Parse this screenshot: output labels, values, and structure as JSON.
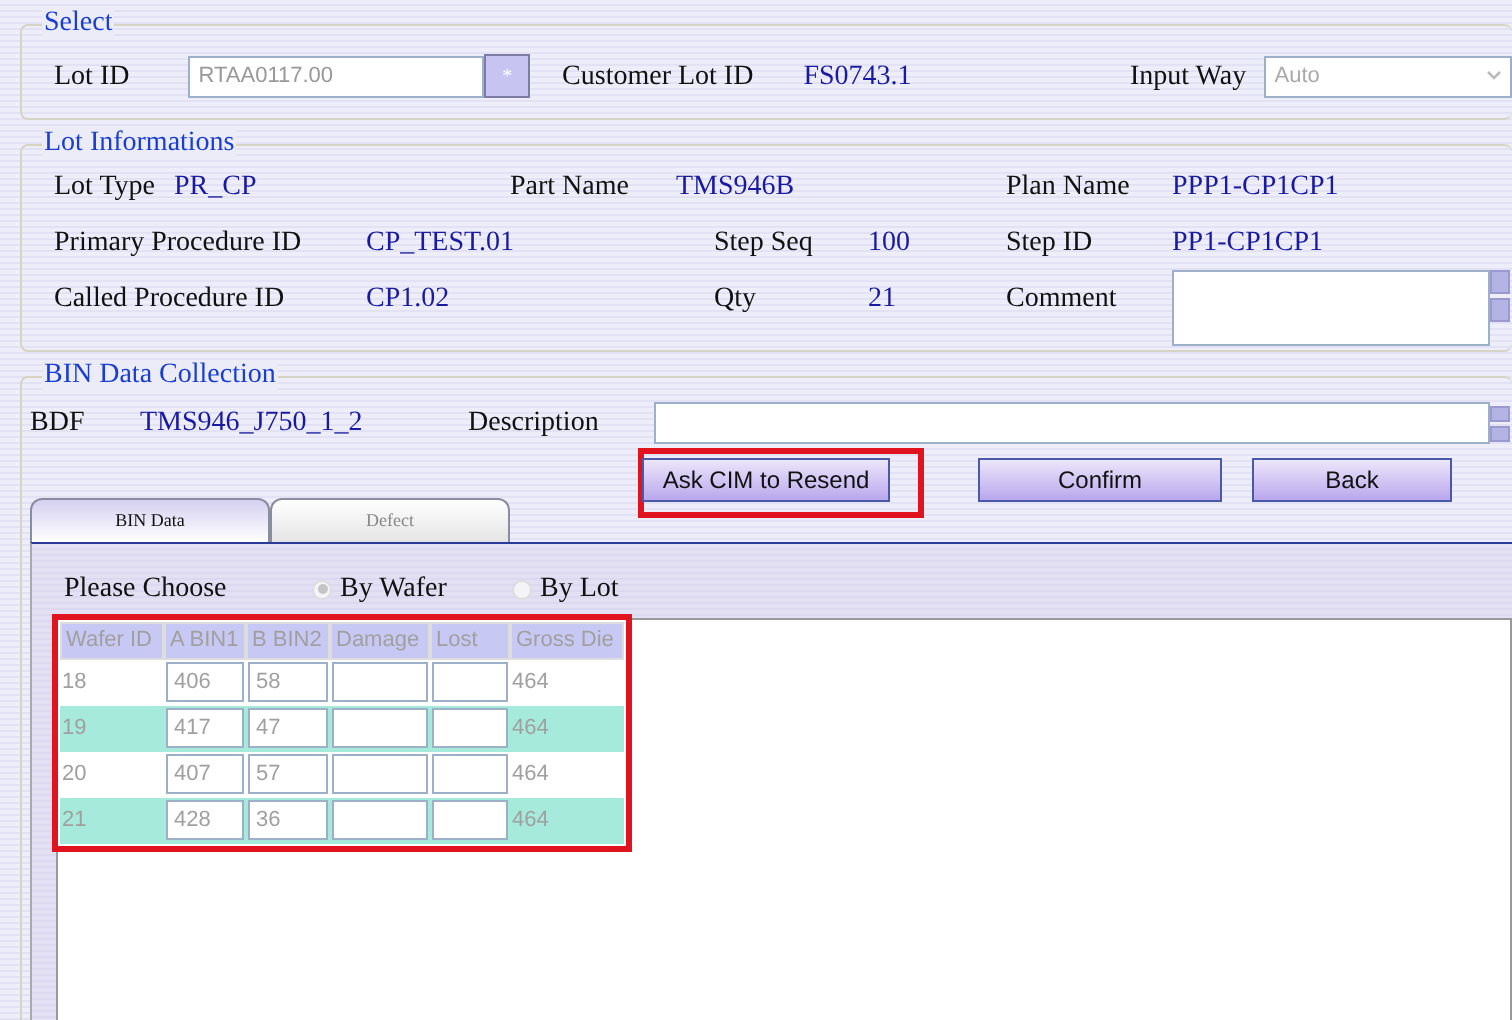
{
  "select": {
    "legend": "Select",
    "lot_id_label": "Lot ID",
    "lot_id_value": "RTAA0117.00",
    "lookup_button": "*",
    "customer_lot_label": "Customer Lot ID",
    "customer_lot_value": "FS0743.1",
    "input_way_label": "Input Way",
    "input_way_value": "Auto",
    "input_way_disabled": true
  },
  "lot_info": {
    "legend": "Lot Informations",
    "rows": [
      [
        {
          "label": "Lot Type",
          "value": "PR_CP"
        },
        {
          "label": "Part Name",
          "value": "TMS946B"
        },
        {
          "label": "Plan Name",
          "value": "PPP1-CP1CP1"
        }
      ],
      [
        {
          "label": "Primary Procedure ID",
          "value": "CP_TEST.01"
        },
        {
          "label": "Step Seq",
          "value": "100"
        },
        {
          "label": "Step ID",
          "value": "PP1-CP1CP1"
        }
      ],
      [
        {
          "label": "Called Procedure ID",
          "value": "CP1.02"
        },
        {
          "label": "Qty",
          "value": "21"
        },
        {
          "label": "Comment",
          "kind": "textarea"
        }
      ]
    ]
  },
  "bin_collection": {
    "legend": "BIN Data Collection",
    "bdf_label": "BDF",
    "bdf_value": "TMS946_J750_1_2",
    "description_label": "Description",
    "buttons": [
      {
        "label": "Ask CIM to Resend",
        "highlighted": true
      },
      {
        "label": "Confirm",
        "highlighted": false
      },
      {
        "label": "Back",
        "highlighted": false
      }
    ],
    "tabs": [
      {
        "label": "BIN Data",
        "selected": true
      },
      {
        "label": "Defect",
        "selected": false
      }
    ],
    "choose_label": "Please Choose",
    "radios": [
      {
        "label": "By Wafer",
        "selected": true
      },
      {
        "label": "By Lot",
        "selected": false
      }
    ],
    "table": {
      "highlighted": true,
      "columns": [
        "Wafer ID",
        "A BIN1",
        "B BIN2",
        "Damage",
        "Lost",
        "Gross Die"
      ],
      "rows": [
        {
          "shaded": false,
          "cells": [
            "18",
            "406",
            "58",
            "",
            "",
            "464"
          ]
        },
        {
          "shaded": true,
          "cells": [
            "19",
            "417",
            "47",
            "",
            "",
            "464"
          ]
        },
        {
          "shaded": false,
          "cells": [
            "20",
            "407",
            "57",
            "",
            "",
            "464"
          ]
        },
        {
          "shaded": true,
          "cells": [
            "21",
            "428",
            "36",
            "",
            "",
            "464"
          ]
        }
      ]
    }
  }
}
